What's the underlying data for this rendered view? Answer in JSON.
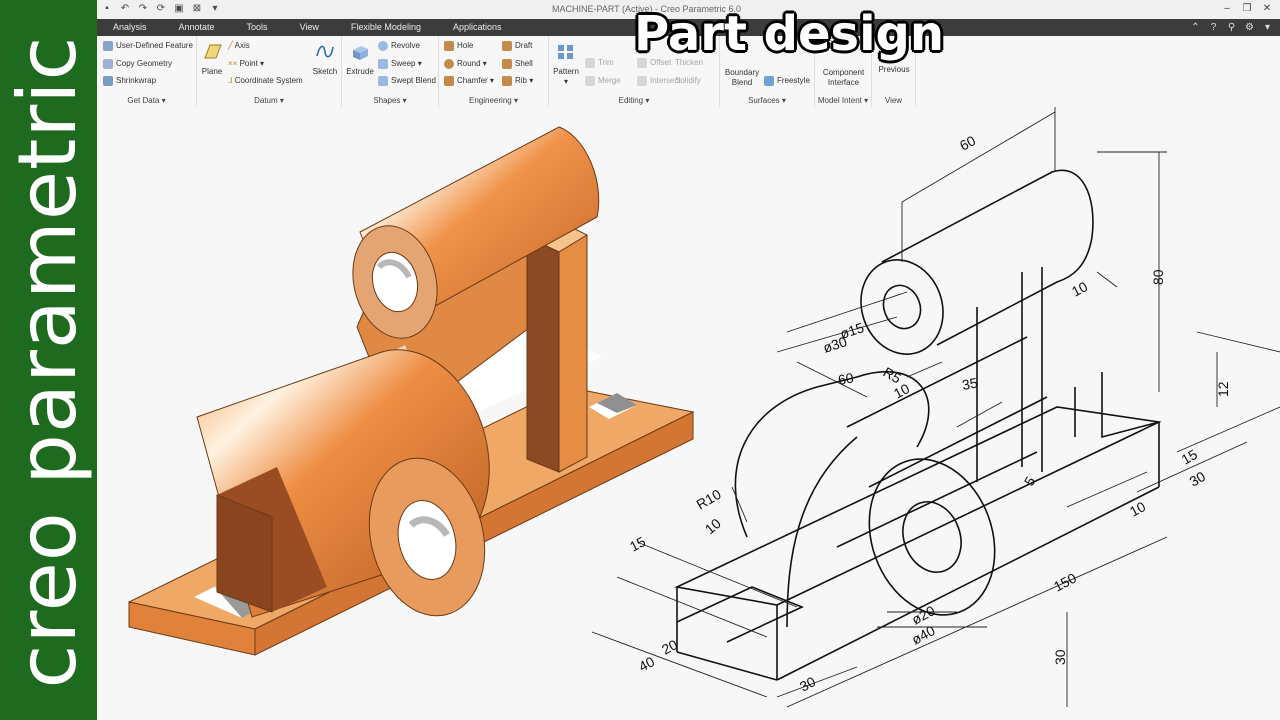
{
  "banner": {
    "text": "creo parametric"
  },
  "overlay": {
    "title": "Part design"
  },
  "window": {
    "title": "MACHINE-PART (Active) - Creo Parametric 6.0"
  },
  "tabs": [
    "Analysis",
    "Annotate",
    "Tools",
    "View",
    "Flexible Modeling",
    "Applications"
  ],
  "ribbon": {
    "get_data": {
      "label": "Get Data",
      "items": [
        "User-Defined Feature",
        "Copy Geometry",
        "Shrinkwrap"
      ]
    },
    "datum": {
      "label": "Datum",
      "plane": "Plane",
      "axis": "Axis",
      "point": "Point",
      "csys": "Coordinate System",
      "sketch": "Sketch"
    },
    "shapes": {
      "label": "Shapes",
      "extrude": "Extrude",
      "revolve": "Revolve",
      "sweep": "Sweep",
      "swept_blend": "Swept Blend"
    },
    "engineering": {
      "label": "Engineering",
      "hole": "Hole",
      "round": "Round",
      "chamfer": "Chamfer",
      "draft": "Draft",
      "shell": "Shell",
      "rib": "Rib"
    },
    "editing": {
      "label": "Editing",
      "pattern": "Pattern",
      "trim": "Trim",
      "offset": "Offset",
      "thicken": "Thicken",
      "merge": "Merge",
      "intersect": "Intersect",
      "solidify": "Solidify"
    },
    "surfaces": {
      "label": "Surfaces",
      "boundary_blend_1": "Boundary",
      "boundary_blend_2": "Blend",
      "freestyle": "Freestyle"
    },
    "model_intent": {
      "label": "Model Intent",
      "component_interface_1": "Component",
      "component_interface_2": "Interface"
    },
    "view": {
      "label": "View",
      "previous": "Previous"
    }
  },
  "drawing": {
    "dims": {
      "d60_top": "60",
      "d80": "80",
      "d10_right": "10",
      "d15_dia": "ø15",
      "d30_dia": "ø30",
      "r5": "R5",
      "d10_r5": "10",
      "d60_side": "60",
      "d35": "35",
      "d12": "12",
      "d15_right": "15",
      "d30_right": "30",
      "d5": "5",
      "d10_base": "10",
      "r10": "R10",
      "d10_left": "10",
      "d15_left": "15",
      "d20_left": "20",
      "d40_left": "40",
      "d150": "150",
      "d20_dia": "ø20",
      "d40_dia": "ø40",
      "d30_bottom": "30",
      "d30_height": "30"
    }
  },
  "colors": {
    "part_orange": "#e8823a",
    "banner_green": "#1e6a1e",
    "tab_bar": "#3c3c3c"
  }
}
